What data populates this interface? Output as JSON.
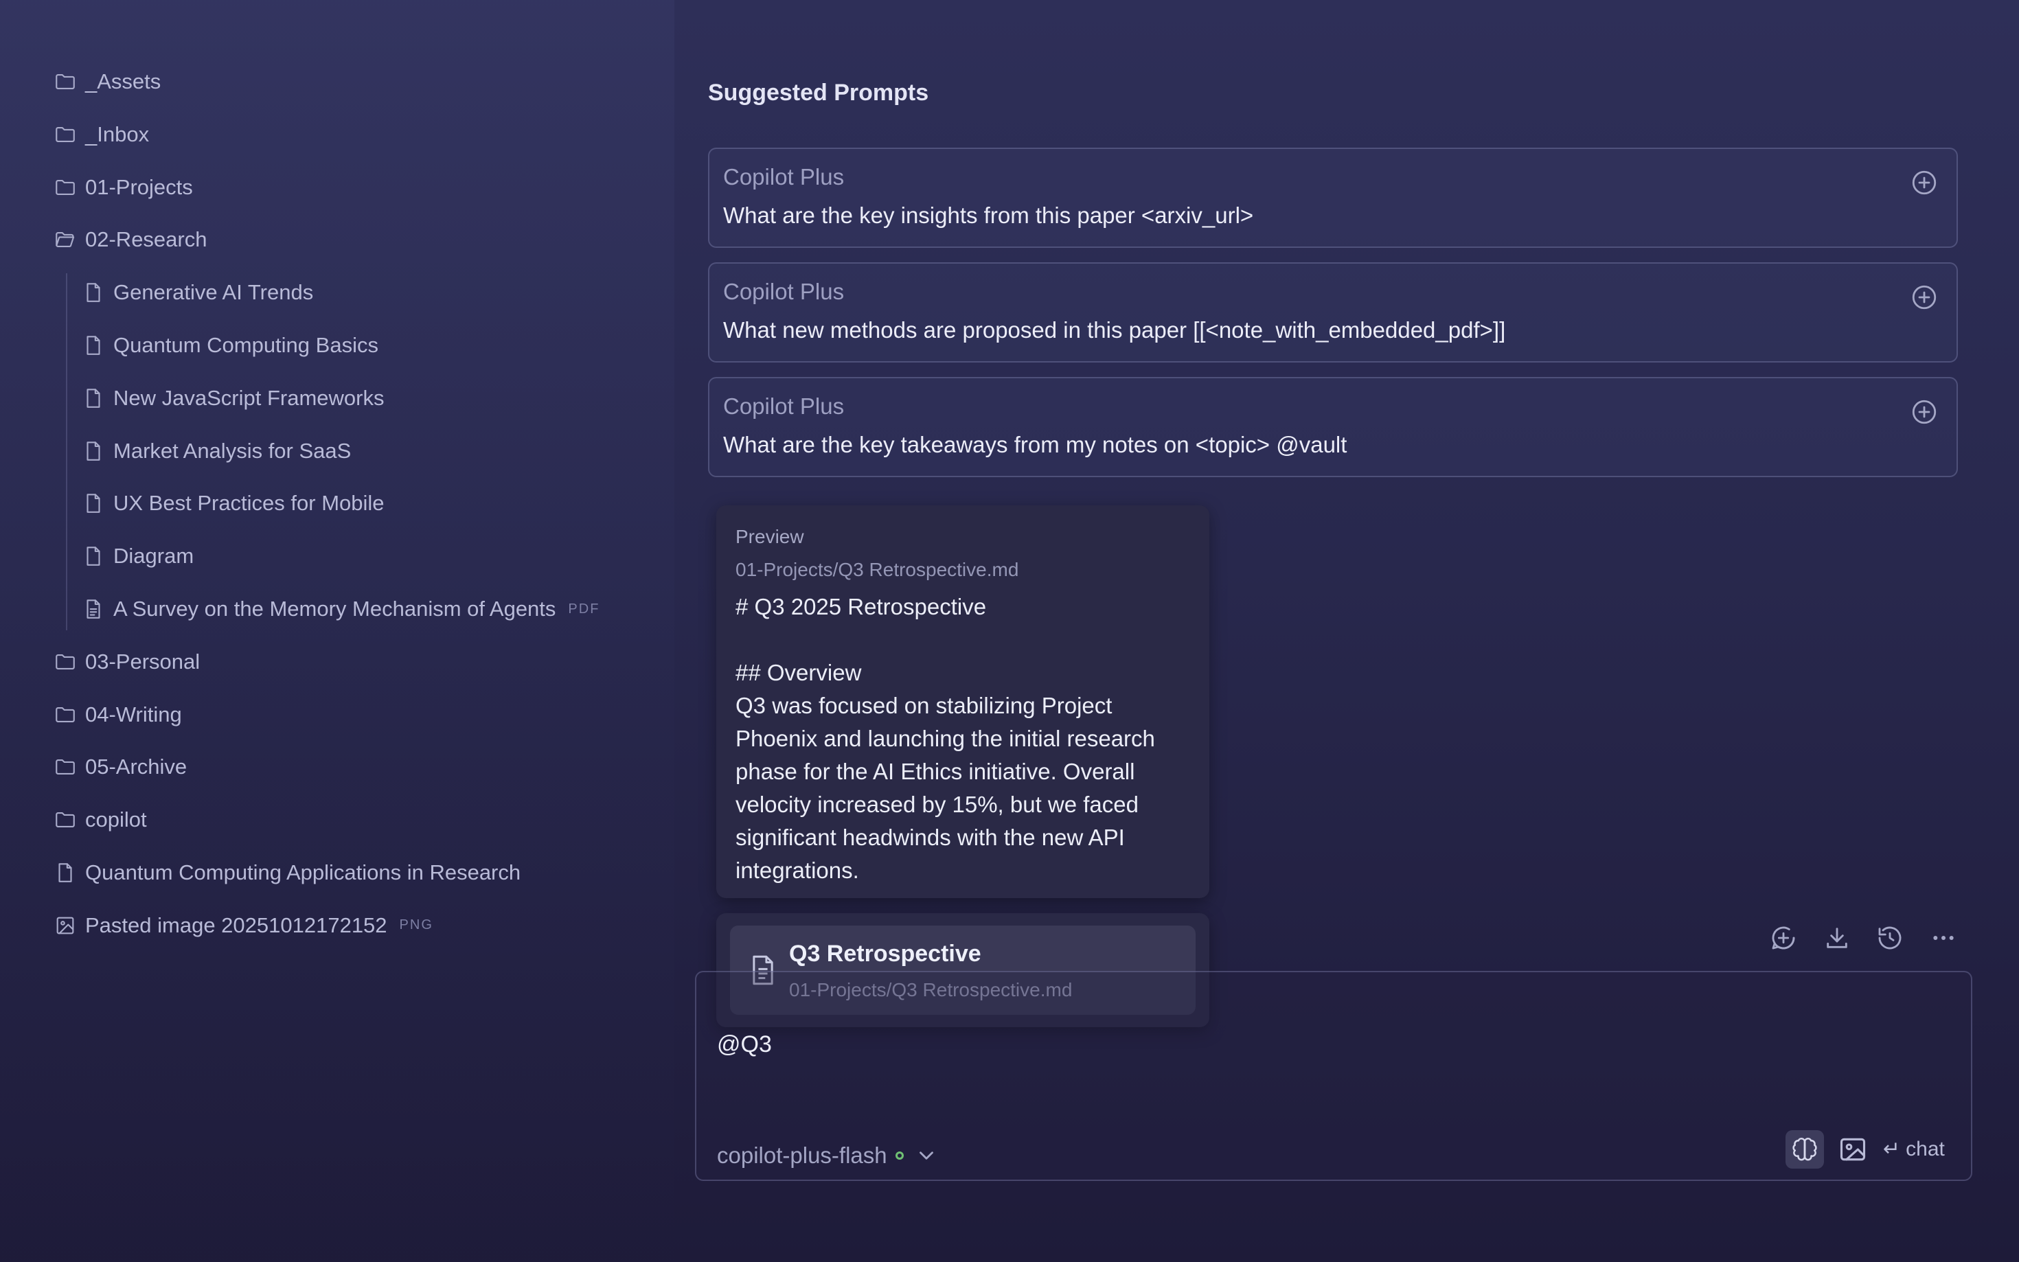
{
  "sidebar": {
    "items": [
      {
        "label": "_Assets",
        "icon": "folder-icon"
      },
      {
        "label": "_Inbox",
        "icon": "folder-icon"
      },
      {
        "label": "01-Projects",
        "icon": "folder-icon"
      },
      {
        "label": "02-Research",
        "icon": "folder-open-icon"
      },
      {
        "label": "Generative AI Trends",
        "icon": "file-icon"
      },
      {
        "label": "Quantum Computing Basics",
        "icon": "file-icon"
      },
      {
        "label": "New JavaScript Frameworks",
        "icon": "file-icon"
      },
      {
        "label": "Market Analysis for SaaS",
        "icon": "file-icon"
      },
      {
        "label": "UX Best Practices for Mobile",
        "icon": "file-icon"
      },
      {
        "label": "Diagram",
        "icon": "file-icon"
      },
      {
        "label": "A Survey on the Memory Mechanism of Agents",
        "icon": "pdf-file-icon",
        "tag": "PDF"
      },
      {
        "label": "03-Personal",
        "icon": "folder-icon"
      },
      {
        "label": "04-Writing",
        "icon": "folder-icon"
      },
      {
        "label": "05-Archive",
        "icon": "folder-icon"
      },
      {
        "label": "copilot",
        "icon": "folder-icon"
      },
      {
        "label": "Quantum Computing Applications in Research",
        "icon": "file-icon"
      },
      {
        "label": "Pasted image 20251012172152",
        "icon": "image-icon",
        "tag": "PNG"
      }
    ]
  },
  "main": {
    "section_title": "Suggested Prompts",
    "prompts": [
      {
        "title": "Copilot Plus",
        "text": "What are the key insights from this paper <arxiv_url>"
      },
      {
        "title": "Copilot Plus",
        "text": "What new methods are proposed in this paper [[<note_with_embedded_pdf>]]"
      },
      {
        "title": "Copilot Plus",
        "text": "What are the key takeaways from my notes on <topic> @vault"
      }
    ]
  },
  "preview": {
    "label": "Preview",
    "path": "01-Projects/Q3 Retrospective.md",
    "body": "# Q3 2025 Retrospective\n\n## Overview\nQ3 was focused on stabilizing Project Phoenix and launching the initial research phase for the AI Ethics initiative. Overall velocity increased by 15%, but we faced significant headwinds with the new API integrations."
  },
  "suggestion": {
    "title": "Q3 Retrospective",
    "path": "01-Projects/Q3 Retrospective.md"
  },
  "toolbar": {
    "icons": [
      "new-chat-icon",
      "download-icon",
      "history-icon",
      "more-icon"
    ]
  },
  "chat": {
    "input_value": "@Q3",
    "model": "copilot-plus-flash",
    "send_label": "chat"
  },
  "colors": {
    "background": "#2a2a50",
    "status_dot": "#6fbf73"
  }
}
